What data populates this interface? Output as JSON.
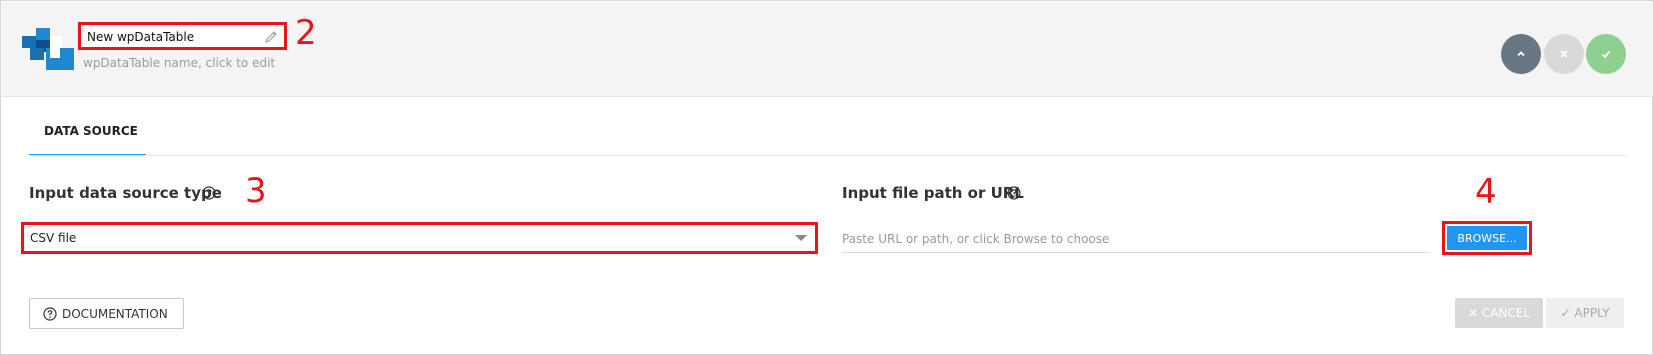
{
  "header": {
    "table_name": "New wpDataTable",
    "name_hint": "wpDataTable name, click to edit",
    "buttons": {
      "collapse_icon": "chevron-up-icon",
      "close_icon": "close-icon",
      "save_icon": "checkmark-icon"
    }
  },
  "annotations": {
    "a2": "2",
    "a3": "3",
    "a4": "4"
  },
  "tabs": [
    {
      "label": "DATA SOURCE",
      "active": true
    }
  ],
  "form": {
    "source_type_label": "Input data source type",
    "source_type_value": "CSV file",
    "file_path_label": "Input file path or URL",
    "file_path_placeholder": "Paste URL or path, or click Browse to choose",
    "browse_label": "BROWSE..."
  },
  "footer": {
    "documentation_label": "DOCUMENTATION",
    "cancel_label": "✕ CANCEL",
    "apply_label": "✓ APPLY"
  },
  "colors": {
    "accent": "#2196f3",
    "highlight": "#e8141c",
    "collapse_button": "#687783",
    "close_button": "#d9d9d9",
    "save_button": "#8fcf8f"
  }
}
